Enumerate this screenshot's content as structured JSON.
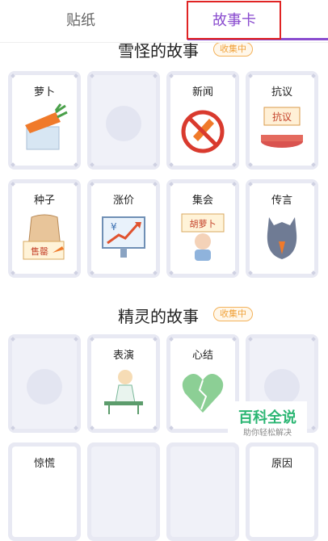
{
  "tabs": {
    "stickers": "贴纸",
    "story_cards": "故事卡"
  },
  "sections": [
    {
      "title": "雪怪的故事",
      "badge": "收集中"
    },
    {
      "title": "精灵的故事",
      "badge": "收集中"
    }
  ],
  "cards": {
    "c1": "萝卜",
    "c3": "新闻",
    "c4": "抗议",
    "c4_sign": "抗议",
    "c5": "种子",
    "c5_sign": "售罄",
    "c6": "涨价",
    "c6_sign": "¥",
    "c7": "集会",
    "c7_sign": "胡萝卜",
    "c8": "传言",
    "c10": "表演",
    "c11": "心结",
    "c13": "惊慌",
    "c16": "原因"
  },
  "watermark": {
    "brand": "百科全说",
    "slogan": "助你轻松解决"
  },
  "colors": {
    "accent": "#8a4ccf",
    "badge": "#f0a23a",
    "card_frame": "#e8e9f3",
    "highlight": "#e02424"
  }
}
